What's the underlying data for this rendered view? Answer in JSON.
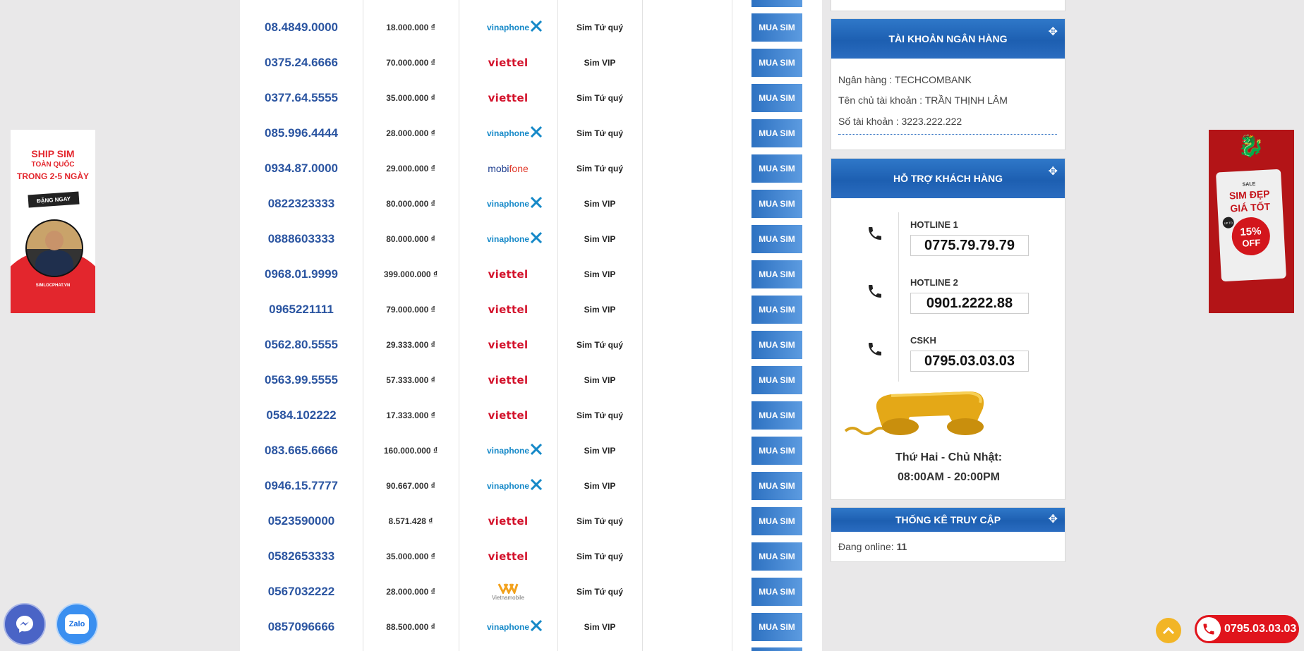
{
  "sim_list": {
    "buy_label": "MUA SIM",
    "rows": [
      {
        "number": "08.4849.0000",
        "price": "18.000.000 ₫",
        "network": "vinaphone",
        "type": "Sim Tứ quý"
      },
      {
        "number": "0375.24.6666",
        "price": "70.000.000 ₫",
        "network": "viettel",
        "type": "Sim VIP"
      },
      {
        "number": "0377.64.5555",
        "price": "35.000.000 ₫",
        "network": "viettel",
        "type": "Sim Tứ quý"
      },
      {
        "number": "085.996.4444",
        "price": "28.000.000 ₫",
        "network": "vinaphone",
        "type": "Sim Tứ quý"
      },
      {
        "number": "0934.87.0000",
        "price": "29.000.000 ₫",
        "network": "mobifone",
        "type": "Sim Tứ quý"
      },
      {
        "number": "0822323333",
        "price": "80.000.000 ₫",
        "network": "vinaphone",
        "type": "Sim VIP"
      },
      {
        "number": "0888603333",
        "price": "80.000.000 ₫",
        "network": "vinaphone",
        "type": "Sim VIP"
      },
      {
        "number": "0968.01.9999",
        "price": "399.000.000 ₫",
        "network": "viettel",
        "type": "Sim VIP"
      },
      {
        "number": "0965221111",
        "price": "79.000.000 ₫",
        "network": "viettel",
        "type": "Sim VIP"
      },
      {
        "number": "0562.80.5555",
        "price": "29.333.000 ₫",
        "network": "viettel",
        "type": "Sim Tứ quý"
      },
      {
        "number": "0563.99.5555",
        "price": "57.333.000 ₫",
        "network": "viettel",
        "type": "Sim VIP"
      },
      {
        "number": "0584.102222",
        "price": "17.333.000 ₫",
        "network": "viettel",
        "type": "Sim Tứ quý"
      },
      {
        "number": "083.665.6666",
        "price": "160.000.000 ₫",
        "network": "vinaphone",
        "type": "Sim VIP"
      },
      {
        "number": "0946.15.7777",
        "price": "90.667.000 ₫",
        "network": "vinaphone",
        "type": "Sim VIP"
      },
      {
        "number": "0523590000",
        "price": "8.571.428 ₫",
        "network": "viettel",
        "type": "Sim Tứ quý"
      },
      {
        "number": "0582653333",
        "price": "35.000.000 ₫",
        "network": "viettel",
        "type": "Sim Tứ quý"
      },
      {
        "number": "0567032222",
        "price": "28.000.000 ₫",
        "network": "vietnamobile",
        "type": "Sim Tứ quý"
      },
      {
        "number": "0857096666",
        "price": "88.500.000 ₫",
        "network": "vinaphone",
        "type": "Sim VIP"
      }
    ]
  },
  "network_logos": {
    "viettel": "viettel",
    "vinaphone": "vinaphone",
    "mobifone_a": "mobi",
    "mobifone_b": "fone",
    "vietnamobile": "Vietnamobile"
  },
  "bank": {
    "title": "TÀI KHOẢN NGÂN HÀNG",
    "bank_name": "Ngân hàng : TECHCOMBANK",
    "holder": "Tên chủ tài khoản : TRẦN THỊNH LÂM",
    "account": "Số tài khoản : 3223.222.222"
  },
  "support": {
    "title": "HỖ TRỢ KHÁCH HÀNG",
    "lines": [
      {
        "label": "HOTLINE 1",
        "phone": "0775.79.79.79"
      },
      {
        "label": "HOTLINE 2",
        "phone": "0901.2222.88"
      },
      {
        "label": "CSKH",
        "phone": "0795.03.03.03"
      }
    ],
    "hours_days": "Thứ Hai - Chủ Nhật:",
    "hours_time": "08:00AM - 20:00PM"
  },
  "stats": {
    "title": "THỐNG KÊ TRUY CẬP",
    "online_label": "Đang online:",
    "online_count": "11"
  },
  "banner_left": {
    "line1": "SHIP SIM",
    "line2": "TOÀN QUỐC",
    "line3": "TRONG 2-5 NGÀY",
    "badge": "ĐẶNG NGAY",
    "footer": "SIMLOCPHAT.VN"
  },
  "banner_right": {
    "sale": "SALE",
    "line1": "SIM ĐẸP",
    "line2": "GIÁ TỐT",
    "upto": "UP TO",
    "percent": "15%",
    "off": "OFF"
  },
  "float": {
    "zalo_label": "Zalo",
    "call_phone": "0795.03.03.03"
  },
  "colors": {
    "accent_blue": "#2b55a1",
    "header_blue": "#1d5fb1",
    "viettel_red": "#d3122b",
    "vina_blue": "#1689c8",
    "call_red": "#e0141c"
  }
}
